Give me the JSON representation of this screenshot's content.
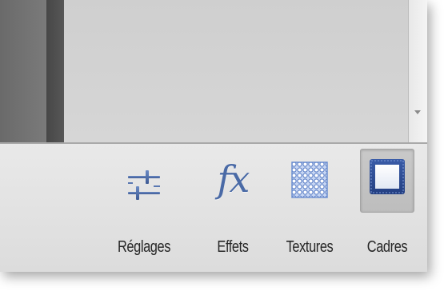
{
  "toolbar": {
    "tools": [
      {
        "label": "Réglages",
        "icon": "sliders-icon",
        "selected": false
      },
      {
        "label": "Effets",
        "icon": "fx-icon",
        "selected": false
      },
      {
        "label": "Textures",
        "icon": "texture-icon",
        "selected": false
      },
      {
        "label": "Cadres",
        "icon": "frame-icon",
        "selected": true
      }
    ],
    "effets_glyph": "fx"
  },
  "colors": {
    "icon_blue": "#4a6aa6",
    "texture_blue": "#6d8fd0",
    "selected_background": "#c4c4c4"
  }
}
